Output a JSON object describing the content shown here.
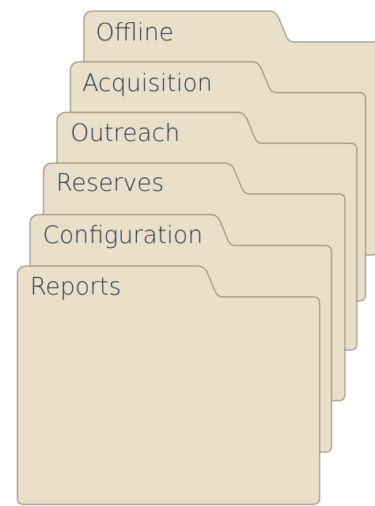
{
  "colors": {
    "folder_fill": "#eae0c9",
    "folder_stroke": "#8a8273",
    "label_text": "#1f3148",
    "background": "#ffffff"
  },
  "folders": [
    {
      "label": "Offline",
      "icon": "folder-icon"
    },
    {
      "label": "Acquisition",
      "icon": "folder-icon"
    },
    {
      "label": "Outreach",
      "icon": "folder-icon"
    },
    {
      "label": "Reserves",
      "icon": "folder-icon"
    },
    {
      "label": "Configuration",
      "icon": "folder-icon"
    },
    {
      "label": "Reports",
      "icon": "folder-icon"
    }
  ]
}
